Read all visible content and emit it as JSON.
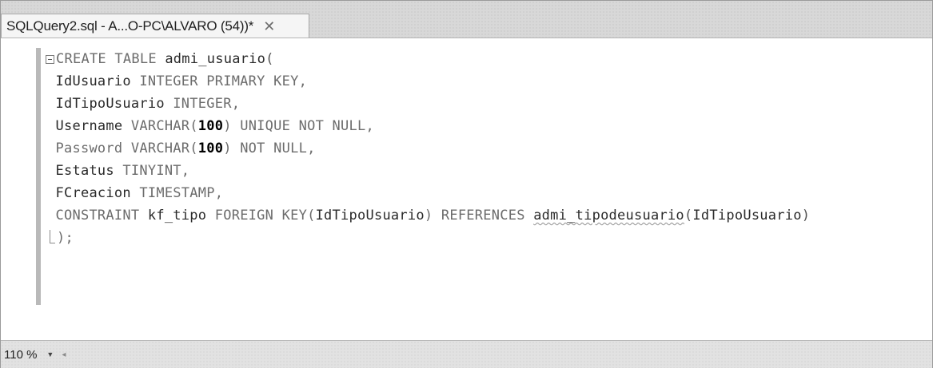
{
  "tab": {
    "title": "SQLQuery2.sql - A...O-PC\\ALVARO (54))*",
    "close_glyph": "✕"
  },
  "editor": {
    "lines": [
      {
        "collapse": true,
        "segments": [
          {
            "t": "CREATE TABLE ",
            "c": "kw"
          },
          {
            "t": "admi_usuario",
            "c": "id"
          },
          {
            "t": "(",
            "c": "punct"
          }
        ]
      },
      {
        "segments": [
          {
            "t": "IdUsuario",
            "c": "id"
          },
          {
            "t": " INTEGER PRIMARY KEY,",
            "c": "kw"
          }
        ]
      },
      {
        "segments": [
          {
            "t": "IdTipoUsuario",
            "c": "id"
          },
          {
            "t": " INTEGER,",
            "c": "kw"
          }
        ]
      },
      {
        "segments": [
          {
            "t": "Username",
            "c": "id"
          },
          {
            "t": " VARCHAR(",
            "c": "kw"
          },
          {
            "t": "100",
            "c": "num"
          },
          {
            "t": ") UNIQUE NOT NULL,",
            "c": "kw"
          }
        ]
      },
      {
        "segments": [
          {
            "t": "Password VARCHAR(",
            "c": "kw"
          },
          {
            "t": "100",
            "c": "num"
          },
          {
            "t": ") NOT NULL,",
            "c": "kw"
          }
        ]
      },
      {
        "segments": [
          {
            "t": "Estatus",
            "c": "id"
          },
          {
            "t": " TINYINT,",
            "c": "kw"
          }
        ]
      },
      {
        "segments": [
          {
            "t": "FCreacion",
            "c": "id"
          },
          {
            "t": " TIMESTAMP,",
            "c": "kw"
          }
        ]
      },
      {
        "segments": [
          {
            "t": "CONSTRAINT ",
            "c": "kw"
          },
          {
            "t": "kf_tipo",
            "c": "id"
          },
          {
            "t": " FOREIGN KEY(",
            "c": "kw"
          },
          {
            "t": "IdTipoUsuario",
            "c": "id"
          },
          {
            "t": ") REFERENCES ",
            "c": "kw"
          },
          {
            "t": "admi_tipodeusuario",
            "c": "id squiggle"
          },
          {
            "t": "(",
            "c": "punct"
          },
          {
            "t": "IdTipoUsuario",
            "c": "id"
          },
          {
            "t": ")",
            "c": "punct"
          }
        ]
      },
      {
        "fold_end": true,
        "segments": [
          {
            "t": ");",
            "c": "kw"
          }
        ]
      }
    ]
  },
  "status": {
    "zoom": "110 %",
    "zoom_arrow": "▼",
    "scroll_left": "◂"
  }
}
